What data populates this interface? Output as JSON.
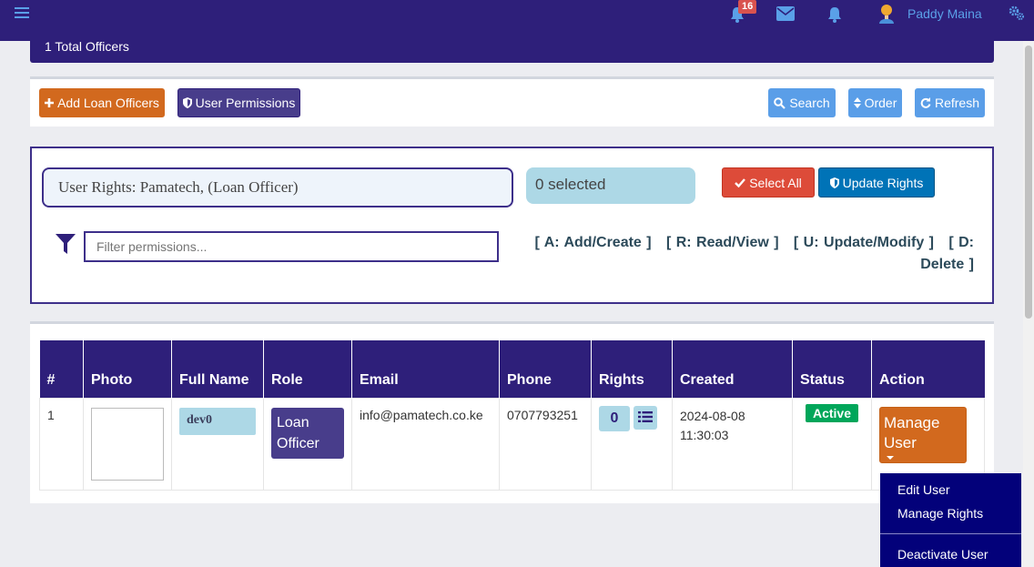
{
  "topnav": {
    "notifications_badge": "16",
    "username": "Paddy Maina"
  },
  "officers_bar": {
    "text": "1 Total Officers"
  },
  "toolbar": {
    "add_label": "Add Loan Officers",
    "permissions_label": "User Permissions",
    "search_label": "Search",
    "order_label": "Order",
    "refresh_label": "Refresh"
  },
  "rights_panel": {
    "user_rights_text": "User Rights: Pamatech, (Loan Officer)",
    "selected_text": "0 selected",
    "select_all_label": "Select All",
    "update_rights_label": "Update Rights",
    "filter_placeholder": "Filter permissions...",
    "legend": [
      "[ A: Add/Create ]",
      "[ R: Read/View ]",
      "[ U: Update/Modify ]",
      "[ D: Delete ]"
    ]
  },
  "table": {
    "headers": [
      "#",
      "Photo",
      "Full Name",
      "Role",
      "Email",
      "Phone",
      "Rights",
      "Created",
      "Status",
      "Action"
    ],
    "rows": [
      {
        "num": "1",
        "full_name": "dev0",
        "role": "Loan Officer",
        "email": "info@pamatech.co.ke",
        "phone": "0707793251",
        "rights_count": "0",
        "created": "2024-08-08 11:30:03",
        "status": "Active",
        "action": "Manage User"
      }
    ]
  },
  "dropdown": {
    "items": [
      "Edit User",
      "Manage Rights",
      "Deactivate User"
    ]
  },
  "colors": {
    "primary": "#2e1f7a",
    "orange": "#d2691e",
    "danger": "#dd4b39",
    "info": "#0073b7",
    "light_blue": "#add8e6",
    "success": "#00a65a"
  }
}
